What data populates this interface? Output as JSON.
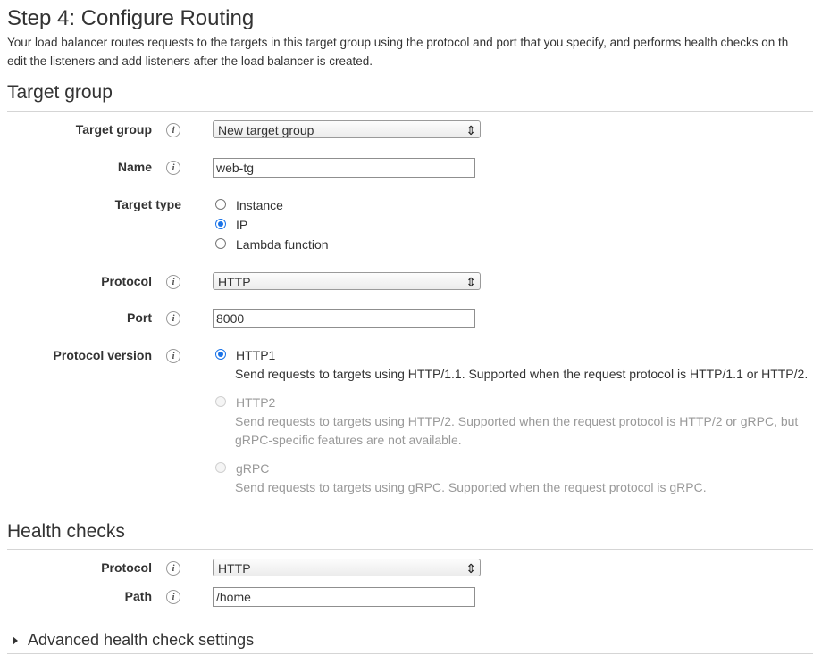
{
  "header": {
    "title": "Step 4: Configure Routing",
    "description_line1": "Your load balancer routes requests to the targets in this target group using the protocol and port that you specify, and performs health checks on th",
    "description_line2": "edit the listeners and add listeners after the load balancer is created."
  },
  "target_group_section": {
    "title": "Target group",
    "target_group": {
      "label": "Target group",
      "value": "New target group"
    },
    "name": {
      "label": "Name",
      "value": "web-tg"
    },
    "target_type": {
      "label": "Target type",
      "options": [
        "Instance",
        "IP",
        "Lambda function"
      ],
      "selected": "IP"
    },
    "protocol": {
      "label": "Protocol",
      "value": "HTTP"
    },
    "port": {
      "label": "Port",
      "value": "8000"
    },
    "protocol_version": {
      "label": "Protocol version",
      "selected": "HTTP1",
      "options": [
        {
          "name": "HTTP1",
          "help": [
            "Send requests to targets using HTTP/1.1. Supported when the request protocol is HTTP/1.1 or HTTP/2."
          ],
          "enabled": true
        },
        {
          "name": "HTTP2",
          "help": [
            "Send requests to targets using HTTP/2. Supported when the request protocol is HTTP/2 or gRPC, but",
            "gRPC-specific features are not available."
          ],
          "enabled": false
        },
        {
          "name": "gRPC",
          "help": [
            "Send requests to targets using gRPC. Supported when the request protocol is gRPC."
          ],
          "enabled": false
        }
      ]
    }
  },
  "health_checks_section": {
    "title": "Health checks",
    "protocol": {
      "label": "Protocol",
      "value": "HTTP"
    },
    "path": {
      "label": "Path",
      "value": "/home"
    }
  },
  "advanced": {
    "label": "Advanced health check settings"
  },
  "icons": {
    "info": "info-icon",
    "dropdown": "chevron-updown-icon",
    "expand": "caret-right-icon"
  },
  "colors": {
    "accent": "#1a73e8",
    "text": "#333333",
    "disabled": "#999999",
    "rule": "#d5d5d5"
  }
}
